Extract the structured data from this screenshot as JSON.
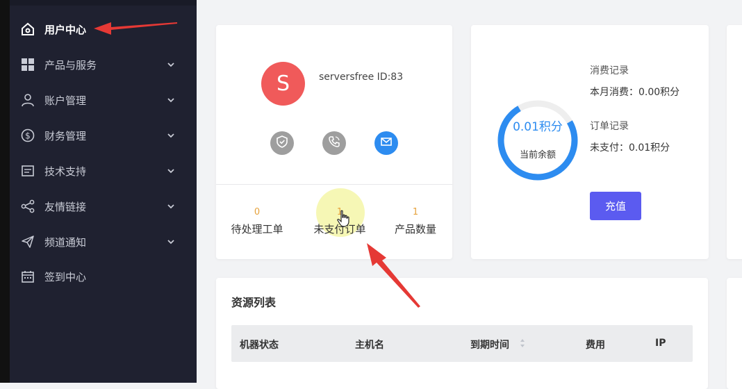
{
  "sidebar": {
    "items": [
      {
        "label": "用户中心",
        "icon": "home-icon",
        "active": true
      },
      {
        "label": "产品与服务",
        "icon": "grid-icon"
      },
      {
        "label": "账户管理",
        "icon": "user-icon"
      },
      {
        "label": "财务管理",
        "icon": "dollar-icon"
      },
      {
        "label": "技术支持",
        "icon": "document-icon"
      },
      {
        "label": "友情链接",
        "icon": "share-icon"
      },
      {
        "label": "频道通知",
        "icon": "send-icon"
      },
      {
        "label": "签到中心",
        "icon": "calendar-icon"
      }
    ]
  },
  "profile": {
    "avatar_letter": "S",
    "username": "serversfree ID:83",
    "stats": [
      {
        "value": "0",
        "label": "待处理工单"
      },
      {
        "value": "1",
        "label": "未支付订单"
      },
      {
        "value": "1",
        "label": "产品数量"
      }
    ]
  },
  "balance": {
    "value": "0.01积分",
    "label": "当前余额",
    "consumption_title": "消费记录",
    "consumption_text": "本月消费：0.00积分",
    "order_title": "订单记录",
    "order_text": "未支付：0.01积分",
    "recharge_label": "充值"
  },
  "resources": {
    "title": "资源列表",
    "columns": [
      "机器状态",
      "主机名",
      "到期时间",
      "费用",
      "IP"
    ]
  },
  "colors": {
    "sidebar_bg": "#1f2130",
    "accent_blue": "#2d8cf0",
    "avatar_red": "#f05a5a",
    "recharge_purple": "#5b5bf0",
    "annotation_red": "#e53935"
  }
}
